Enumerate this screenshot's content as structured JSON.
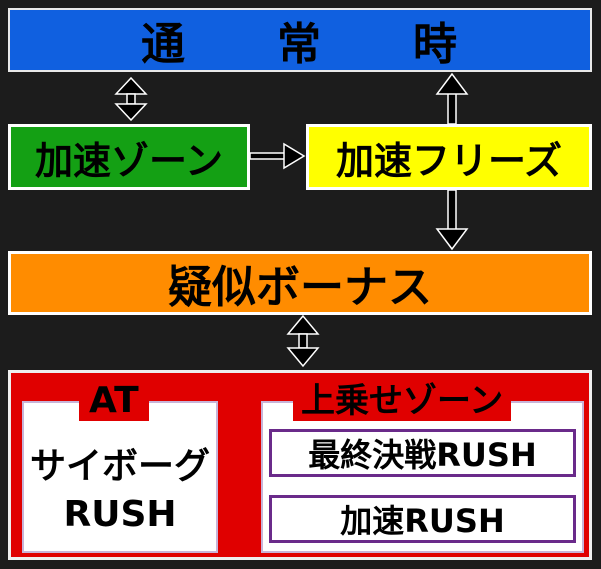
{
  "nodes": {
    "normal": "通常時",
    "normal_chars": [
      "通",
      "常",
      "時"
    ],
    "kasoku_zone": "加速ゾーン",
    "kasoku_freeze": "加速フリーズ",
    "giji_bonus": "疑似ボーナス",
    "at_title": "AT",
    "at_line1": "サイボーグ",
    "at_line2": "RUSH",
    "uwanose_zone": "上乗せゾーン",
    "saishu_kessen": "最終決戦RUSH",
    "kasoku_rush": "加速RUSH"
  }
}
